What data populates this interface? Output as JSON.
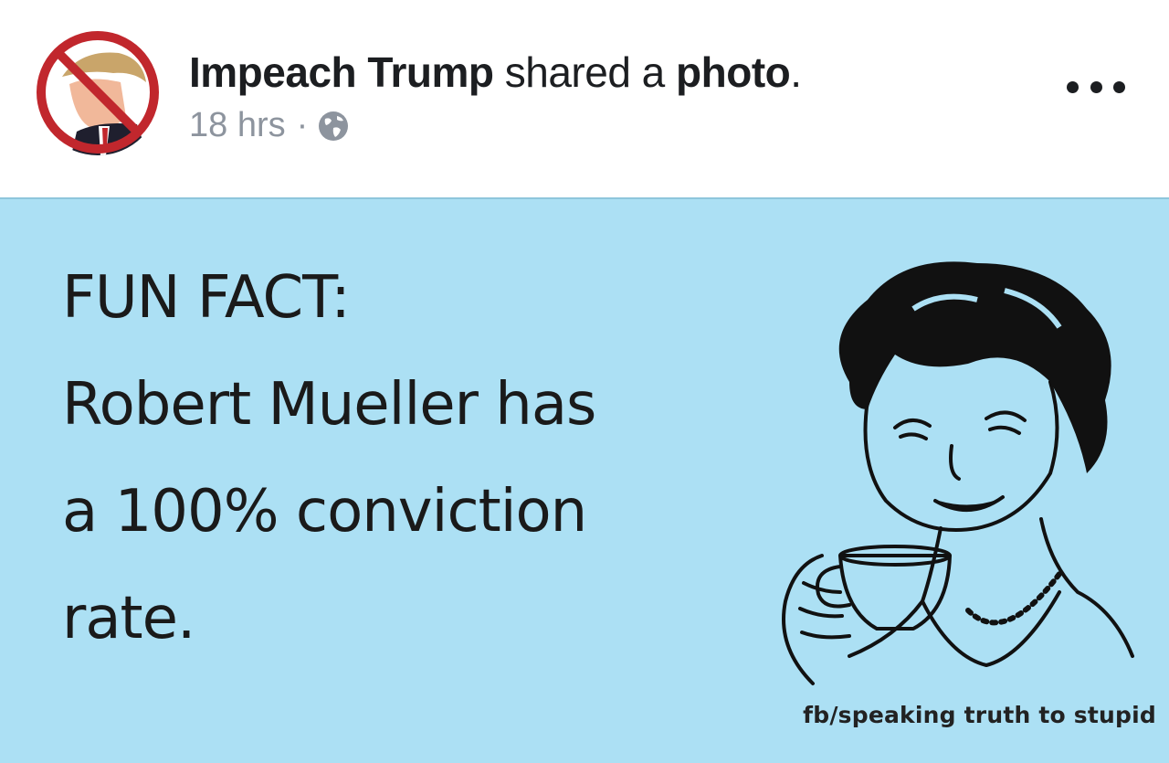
{
  "post": {
    "author": "Impeach Trump",
    "action_text": "shared a",
    "object": "photo",
    "period": ".",
    "time": "18 hrs",
    "separator": "·",
    "privacy_icon": "globe-icon",
    "more_icon": "more-options-icon"
  },
  "photo": {
    "lines": [
      "FUN FACT:",
      "Robert Mueller has",
      "a 100% conviction",
      "rate."
    ],
    "watermark": "fb/speaking truth to stupid",
    "background": "#ace0f4"
  },
  "colors": {
    "text": "#1c1e21",
    "meta": "#8d949e",
    "ban_red": "#c1272d"
  }
}
